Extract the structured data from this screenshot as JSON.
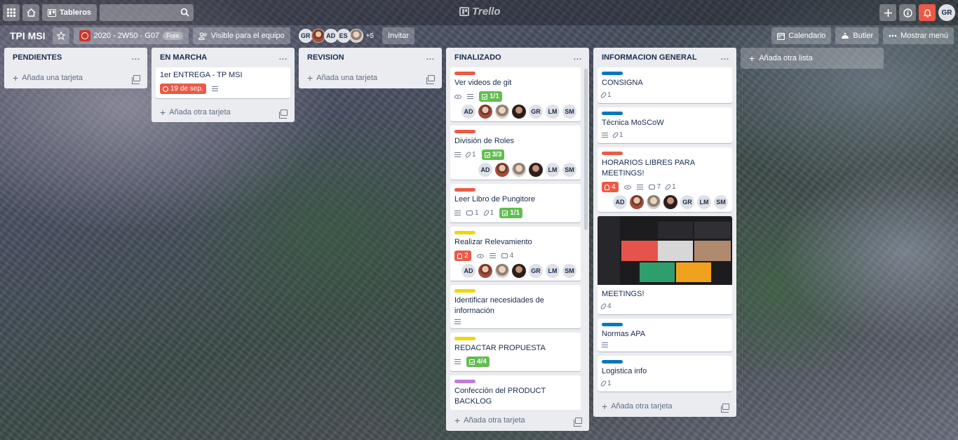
{
  "topbar": {
    "boards_label": "Tableros",
    "search_placeholder": "",
    "logo_text": "Trello",
    "user_initials": "GR"
  },
  "board": {
    "title": "TPI MSI",
    "team_name": "2020 - 2W50 - G07",
    "team_plan": "Free",
    "visibility": "Visible para el equipo",
    "members": [
      "GR",
      "",
      "AD",
      "ES",
      ""
    ],
    "more_members": "+5",
    "invite_label": "Invitar",
    "calendar_label": "Calendario",
    "butler_label": "Butler",
    "menu_label": "Mostrar menú",
    "add_list_label": "Añada otra lista"
  },
  "lists": [
    {
      "title": "PENDIENTES",
      "menu": "...",
      "footer": "Añada una tarjeta"
    },
    {
      "title": "EN MARCHA",
      "menu": "...",
      "footer": "Añada otra tarjeta",
      "cards": [
        {
          "title": "1er ENTREGA - TP MSI",
          "due": "19 de sep."
        }
      ]
    },
    {
      "title": "REVISION",
      "menu": "...",
      "footer": "Añada una tarjeta"
    },
    {
      "title": "FINALIZADO",
      "menu": "...",
      "footer": "Añada otra tarjeta",
      "cards": [
        {
          "label": "red",
          "title": "Ver videos de git",
          "checklist": "1/1",
          "members": [
            "AD",
            "",
            "",
            "",
            "GR",
            "LM",
            "SM"
          ]
        },
        {
          "label": "red",
          "title": "División de Roles",
          "attachments": "1",
          "checklist": "3/3",
          "members": [
            "AD",
            "",
            "",
            "",
            "LM",
            "SM"
          ]
        },
        {
          "label": "red",
          "title": "Leer Libro de Pungitore",
          "comments": "1",
          "attachments": "1",
          "checklist": "1/1"
        },
        {
          "label": "yellow",
          "title": "Realizar Relevamiento",
          "notifications": "2",
          "comments": "4",
          "members": [
            "AD",
            "",
            "",
            "",
            "GR",
            "LM",
            "SM"
          ]
        },
        {
          "label": "yellow",
          "title": "Identificar necesidades de información"
        },
        {
          "label": "yellow",
          "title": "REDACTAR PROPUESTA",
          "checklist": "4/4"
        },
        {
          "label": "purple",
          "title": "Confección del PRODUCT BACKLOG"
        }
      ]
    },
    {
      "title": "INFORMACION GENERAL",
      "menu": "...",
      "footer": "Añada otra tarjeta",
      "cards": [
        {
          "label": "blue",
          "title": "CONSIGNA",
          "attachments": "1"
        },
        {
          "label": "blue",
          "title": "Técnica MoSCoW",
          "attachments": "1"
        },
        {
          "label": "red",
          "title": "HORARIOS LIBRES PARA MEETINGS!",
          "notifications": "4",
          "comments": "7",
          "attachments": "1",
          "members": [
            "AD",
            "",
            "",
            "",
            "GR",
            "LM",
            "SM"
          ]
        },
        {
          "title": "MEETINGS!",
          "attachments": "4"
        },
        {
          "label": "blue",
          "title": "Normas APA"
        },
        {
          "label": "blue",
          "title": "Logistica info",
          "attachments": "1"
        }
      ]
    }
  ],
  "colors": {
    "label_red": "#eb5a46",
    "label_blue": "#0079bf",
    "label_yellow": "#f2d600",
    "label_purple": "#c377e0",
    "badge_green": "#61bd4f"
  }
}
